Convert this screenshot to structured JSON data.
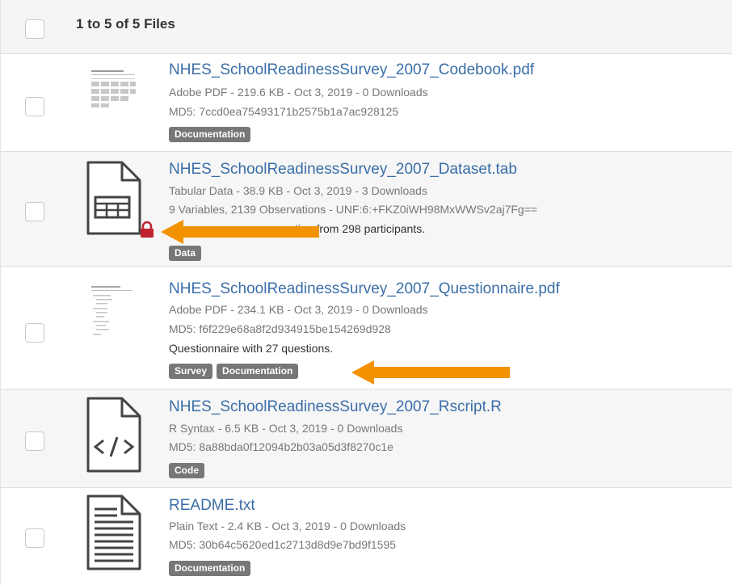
{
  "header": {
    "title": "1 to 5 of 5 Files"
  },
  "files": [
    {
      "name": "NHES_SchoolReadinessSurvey_2007_Codebook.pdf",
      "meta": "Adobe PDF - 219.6 KB - Oct 3, 2019 - 0 Downloads",
      "checksum": "MD5: 7ccd0ea75493171b2575b1a7ac928125",
      "tags": [
        "Documentation"
      ],
      "thumbnail": "pdf-page-thumbnail"
    },
    {
      "name": "NHES_SchoolReadinessSurvey_2007_Dataset.tab",
      "meta": "Tabular Data - 38.9 KB - Oct 3, 2019 - 3 Downloads",
      "checksum": "9 Variables, 2139 Observations - UNF:6:+FKZ0iWH98MxWWSv2aj7Fg==",
      "description": "tion from 298 participants.",
      "tags": [
        "Data"
      ],
      "thumbnail": "tabular-file-icon",
      "lock": "lock-icon"
    },
    {
      "name": "NHES_SchoolReadinessSurvey_2007_Questionnaire.pdf",
      "meta": "Adobe PDF - 234.1 KB - Oct 3, 2019 - 0 Downloads",
      "checksum": "MD5: f6f229e68a8f2d934915be154269d928",
      "description": "Questionnaire with 27 questions.",
      "tags": [
        "Survey",
        "Documentation"
      ],
      "thumbnail": "pdf-page-thumbnail"
    },
    {
      "name": "NHES_SchoolReadinessSurvey_2007_Rscript.R",
      "meta": "R Syntax - 6.5 KB - Oct 3, 2019 - 0 Downloads",
      "checksum": "MD5: 8a88bda0f12094b2b03a05d3f8270c1e",
      "tags": [
        "Code"
      ],
      "thumbnail": "code-file-icon"
    },
    {
      "name": "README.txt",
      "meta": "Plain Text - 2.4 KB - Oct 3, 2019 - 0 Downloads",
      "checksum": "MD5: 30b64c5620ed1c2713d8d9e7bd9f1595",
      "tags": [
        "Documentation"
      ],
      "thumbnail": "text-file-icon"
    }
  ],
  "colors": {
    "link": "#3a6ea8",
    "tag": "#777777",
    "arrow": "#f39200",
    "lock": "#c0222e"
  }
}
